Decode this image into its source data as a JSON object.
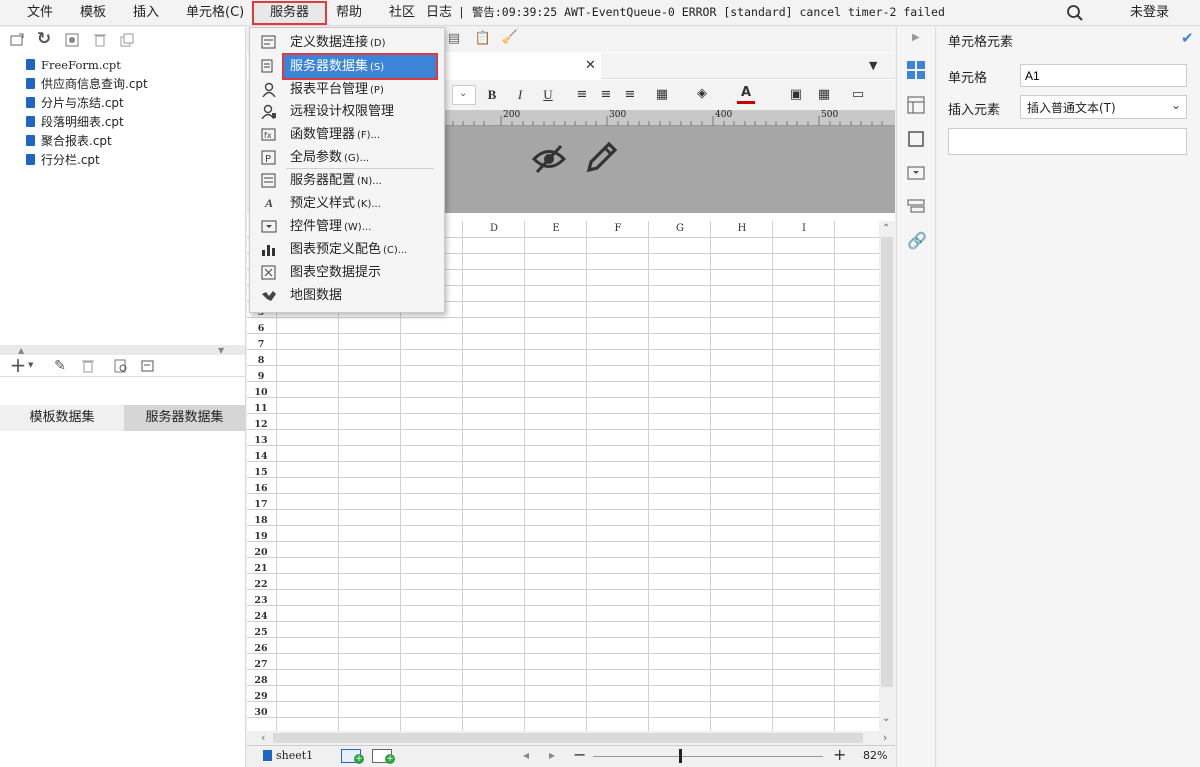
{
  "menubar": {
    "items": [
      "文件",
      "模板",
      "插入",
      "单元格(C)",
      "服务器",
      "帮助",
      "社区",
      "日志"
    ],
    "log_line": "| 警告:09:39:25 AWT-EventQueue-0 ERROR [standard] cancel timer-2 failed",
    "login": "未登录"
  },
  "files": [
    "FreeForm.cpt",
    "供应商信息查询.cpt",
    "分片与冻结.cpt",
    "段落明细表.cpt",
    "聚合报表.cpt",
    "行分栏.cpt"
  ],
  "dataset_tabs": {
    "template": "模板数据集",
    "server": "服务器数据集"
  },
  "server_menu": [
    {
      "icon": "db-connection-icon",
      "label": "定义数据连接",
      "shortcut": "(D)"
    },
    {
      "icon": "server-dataset-icon",
      "label": "服务器数据集",
      "shortcut": "(S)"
    },
    {
      "icon": "user-platform-icon",
      "label": "报表平台管理",
      "shortcut": "(P)"
    },
    {
      "icon": "user-permission-icon",
      "label": "远程设计权限管理",
      "shortcut": ""
    },
    {
      "icon": "function-manager-icon",
      "label": "函数管理器",
      "shortcut": "(F)..."
    },
    {
      "icon": "global-param-icon",
      "label": "全局参数",
      "shortcut": "(G)..."
    },
    {
      "icon": "server-config-icon",
      "label": "服务器配置",
      "shortcut": "(N)..."
    },
    {
      "icon": "predefined-style-icon",
      "label": "预定义样式",
      "shortcut": "(K)..."
    },
    {
      "icon": "widget-manager-icon",
      "label": "控件管理",
      "shortcut": "(W)..."
    },
    {
      "icon": "chart-color-icon",
      "label": "图表预定义配色",
      "shortcut": "(C)..."
    },
    {
      "icon": "chart-empty-icon",
      "label": "图表空数据提示",
      "shortcut": ""
    },
    {
      "icon": "map-data-icon",
      "label": "地图数据",
      "shortcut": ""
    }
  ],
  "ruler": [
    "200",
    "300",
    "400",
    "500"
  ],
  "columns": [
    "D",
    "E",
    "F",
    "G",
    "H",
    "I"
  ],
  "rows": [
    "5",
    "6",
    "7",
    "8",
    "9",
    "10",
    "11",
    "12",
    "13",
    "14",
    "15",
    "16",
    "17",
    "18",
    "19",
    "20",
    "21",
    "22",
    "23",
    "24",
    "25",
    "26",
    "27",
    "28",
    "29",
    "30"
  ],
  "sheet_tab": "sheet1",
  "zoom": "82%",
  "prop_panel": {
    "title": "单元格元素",
    "cell_label": "单元格",
    "cell_value": "A1",
    "insert_label": "插入元素",
    "insert_value": "插入普通文本(T)"
  },
  "colors": {
    "accent": "#3b84d8",
    "highlight": "#e0393e",
    "file_icon": "#1f66c4"
  }
}
